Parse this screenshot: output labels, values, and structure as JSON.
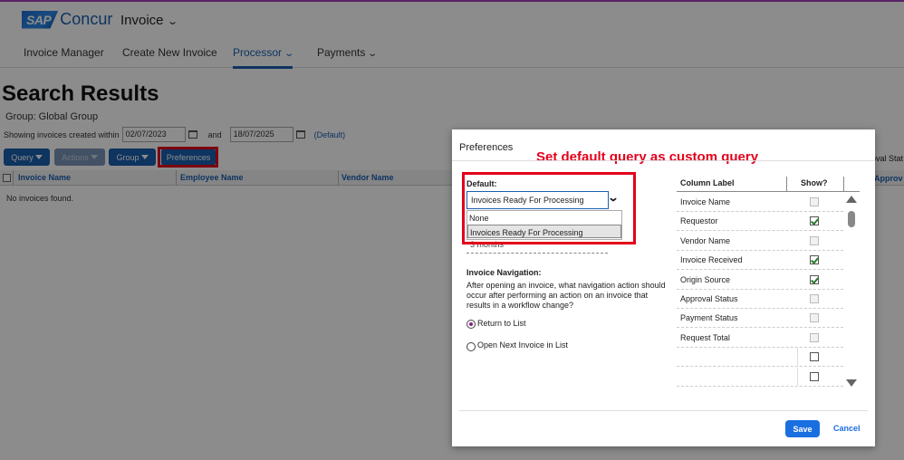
{
  "app": {
    "brand_sap": "SAP",
    "brand_name": "Concur",
    "module": "Invoice"
  },
  "nav": {
    "items": [
      {
        "label": "Invoice Manager"
      },
      {
        "label": "Create New Invoice"
      },
      {
        "label": "Processor"
      },
      {
        "label": "Payments"
      }
    ]
  },
  "page": {
    "title": "Search Results",
    "group": "Group: Global Group",
    "showing_prefix": "Showing invoices created within",
    "date_from": "02/07/2023",
    "and": "and",
    "date_to": "18/07/2025",
    "default_link": "(Default)"
  },
  "toolbar": {
    "query": "Query",
    "actions": "Actions",
    "group": "Group",
    "preferences": "Preferences"
  },
  "grid": {
    "columns": [
      "Invoice Name",
      "Employee Name",
      "Vendor Name"
    ],
    "empty_message": "No invoices found.",
    "peek_right_1": "oval Stat",
    "peek_right_2": "Approv"
  },
  "dialog": {
    "title": "Preferences",
    "annotation": "Set default query as custom query",
    "default_label": "Default:",
    "default_value": "Invoices Ready For Processing",
    "dropdown_options": [
      "None",
      "Invoices Ready For Processing"
    ],
    "hidden_text": "3 months",
    "navigation_title": "Invoice Navigation:",
    "navigation_desc": "After opening an invoice, what navigation action should occur after performing an action on an invoice that results in a workflow change?",
    "radio_return": "Return to List",
    "radio_next": "Open Next Invoice in List",
    "col_label_header": "Column Label",
    "show_header": "Show?",
    "columns": [
      {
        "label": "Invoice Name",
        "state": "disabled"
      },
      {
        "label": "Requestor",
        "state": "checked"
      },
      {
        "label": "Vendor Name",
        "state": "disabled"
      },
      {
        "label": "Invoice Received",
        "state": "checked"
      },
      {
        "label": "Origin Source",
        "state": "checked"
      },
      {
        "label": "Approval Status",
        "state": "disabled"
      },
      {
        "label": "Payment Status",
        "state": "disabled"
      },
      {
        "label": "Request Total",
        "state": "disabled"
      },
      {
        "label": "",
        "state": "empty"
      },
      {
        "label": "",
        "state": "empty"
      }
    ],
    "save": "Save",
    "cancel": "Cancel"
  },
  "colors": {
    "accent": "#1a5fb0",
    "highlight": "#e3001b",
    "save": "#1a6fe0"
  }
}
